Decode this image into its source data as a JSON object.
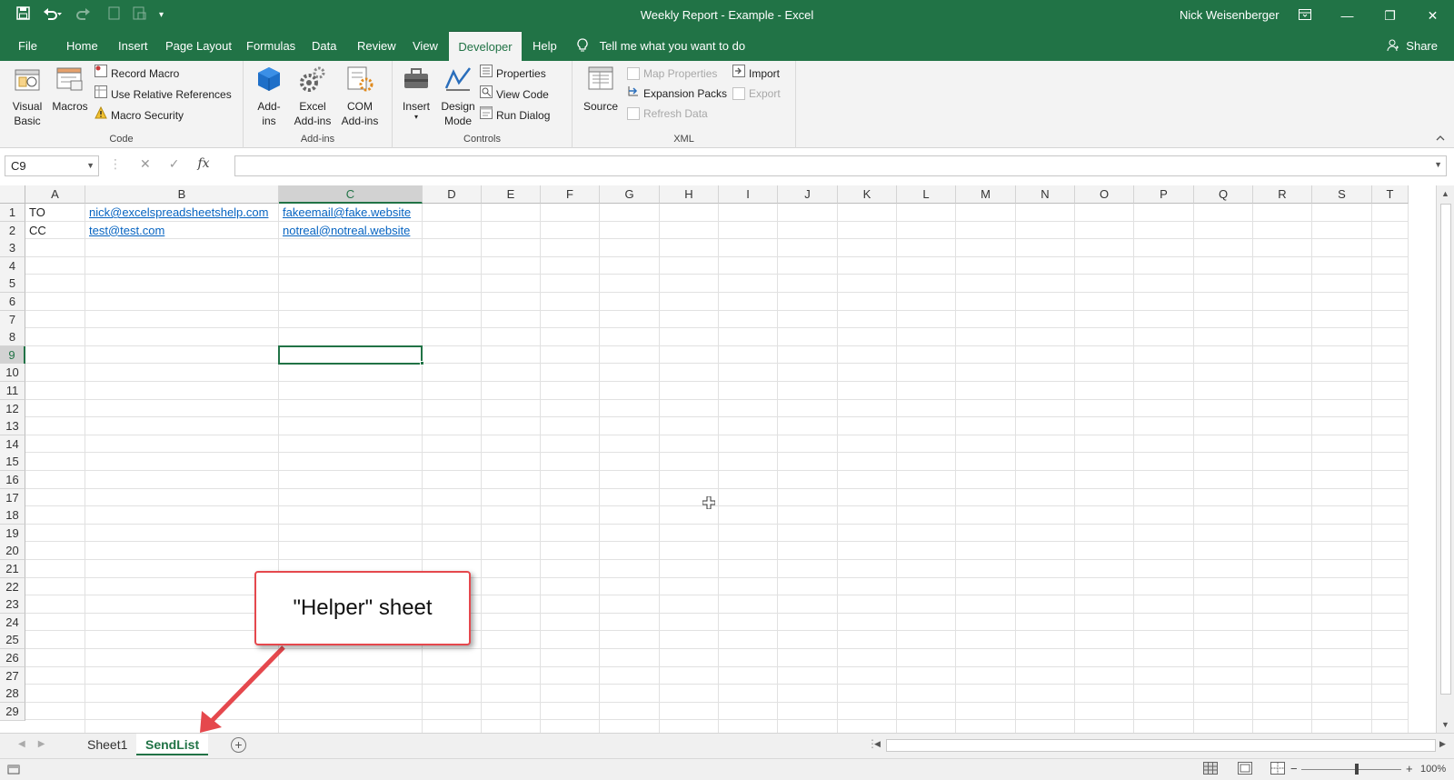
{
  "title": {
    "window_title": "Weekly Report - Example  -  Excel",
    "user": "Nick Weisenberger",
    "minimize": "—",
    "restore": "❐",
    "close": "✕"
  },
  "qat": {
    "save": "💾",
    "undo": "↶",
    "redo": "↷",
    "customize": "▾"
  },
  "tabs": [
    "File",
    "Home",
    "Insert",
    "Page Layout",
    "Formulas",
    "Data",
    "Review",
    "View",
    "Developer",
    "Help"
  ],
  "active_tab": "Developer",
  "tell_me": "Tell me what you want to do",
  "share": "Share",
  "ribbon": {
    "code": {
      "label": "Code",
      "visual_basic": "Visual Basic",
      "macros": "Macros",
      "record_macro": "Record Macro",
      "use_relative": "Use Relative References",
      "macro_security": "Macro Security"
    },
    "addins": {
      "label": "Add-ins",
      "addins": "Add-ins",
      "excel_addins": "Excel Add-ins",
      "com_addins": "COM Add-ins"
    },
    "controls": {
      "label": "Controls",
      "insert": "Insert",
      "design_mode": "Design Mode",
      "properties": "Properties",
      "view_code": "View Code",
      "run_dialog": "Run Dialog"
    },
    "xml": {
      "label": "XML",
      "source": "Source",
      "map_properties": "Map Properties",
      "expansion_packs": "Expansion Packs",
      "refresh_data": "Refresh Data",
      "import": "Import",
      "export": "Export"
    }
  },
  "formula_bar": {
    "name_box": "C9",
    "fx": "fx",
    "value": ""
  },
  "columns": [
    "A",
    "B",
    "C",
    "D",
    "E",
    "F",
    "G",
    "H",
    "I",
    "J",
    "K",
    "L",
    "M",
    "N",
    "O",
    "P",
    "Q",
    "R",
    "S",
    "T"
  ],
  "rows": [
    "1",
    "2",
    "3",
    "4",
    "5",
    "6",
    "7",
    "8",
    "9",
    "10",
    "11",
    "12",
    "13",
    "14",
    "15",
    "16",
    "17",
    "18",
    "19",
    "20",
    "21",
    "22",
    "23",
    "24",
    "25",
    "26",
    "27",
    "28",
    "29"
  ],
  "cells": {
    "A1": "TO",
    "B1": "nick@excelspreadsheetshelp.com",
    "C1": "fakeemail@fake.website",
    "A2": "CC",
    "B2": "test@test.com",
    "C2": "notreal@notreal.website"
  },
  "selected_cell": "C9",
  "sheets": [
    "Sheet1",
    "SendList"
  ],
  "active_sheet": "SendList",
  "zoom": "100%",
  "callout_text": "\"Helper\" sheet",
  "colors": {
    "excel_green": "#217346",
    "link": "#0563c1",
    "callout_border": "#e5484d",
    "arrow": "#e5484d"
  }
}
